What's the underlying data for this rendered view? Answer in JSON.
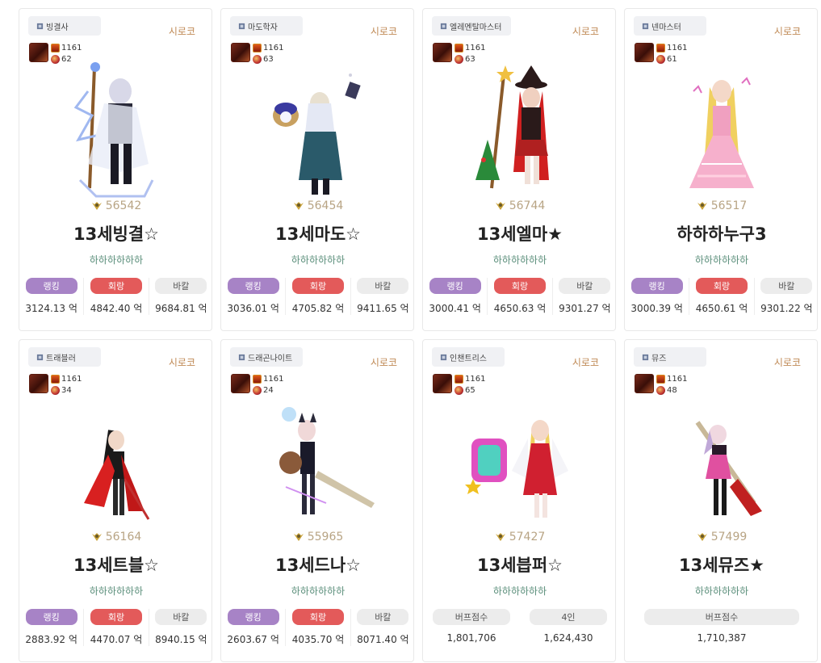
{
  "colors": {
    "rank": "#a783c6",
    "hero": "#e35a5a",
    "bakal": "#ececec",
    "server": "#c08a56",
    "adventure": "#5a8e7a",
    "fame": "#b8a484"
  },
  "cards": [
    {
      "job": "빙결사",
      "server": "시로코",
      "emblem_level": "1161",
      "sub_level": "62",
      "fame": "56542",
      "name": "13세빙결☆",
      "adventure": "하하하하하하",
      "stats": [
        {
          "label": "랭킹",
          "value": "3124.13 억"
        },
        {
          "label": "회랑",
          "value": "4842.40 억"
        },
        {
          "label": "바칼",
          "value": "9684.81 억"
        }
      ]
    },
    {
      "job": "마도학자",
      "server": "시로코",
      "emblem_level": "1161",
      "sub_level": "63",
      "fame": "56454",
      "name": "13세마도☆",
      "adventure": "하하하하하하",
      "stats": [
        {
          "label": "랭킹",
          "value": "3036.01 억"
        },
        {
          "label": "회랑",
          "value": "4705.82 억"
        },
        {
          "label": "바칼",
          "value": "9411.65 억"
        }
      ]
    },
    {
      "job": "엘레멘탈마스터",
      "server": "시로코",
      "emblem_level": "1161",
      "sub_level": "63",
      "fame": "56744",
      "name": "13세엘마★",
      "adventure": "하하하하하하",
      "stats": [
        {
          "label": "랭킹",
          "value": "3000.41 억"
        },
        {
          "label": "회랑",
          "value": "4650.63 억"
        },
        {
          "label": "바칼",
          "value": "9301.27 억"
        }
      ]
    },
    {
      "job": "넨마스터",
      "server": "시로코",
      "emblem_level": "1161",
      "sub_level": "61",
      "fame": "56517",
      "name": "하하하누구3",
      "adventure": "하하하하하하",
      "stats": [
        {
          "label": "랭킹",
          "value": "3000.39 억"
        },
        {
          "label": "회랑",
          "value": "4650.61 억"
        },
        {
          "label": "바칼",
          "value": "9301.22 억"
        }
      ]
    },
    {
      "job": "트래블러",
      "server": "시로코",
      "emblem_level": "1161",
      "sub_level": "34",
      "fame": "56164",
      "name": "13세트블☆",
      "adventure": "하하하하하하",
      "stats": [
        {
          "label": "랭킹",
          "value": "2883.92 억"
        },
        {
          "label": "회랑",
          "value": "4470.07 억"
        },
        {
          "label": "바칼",
          "value": "8940.15 억"
        }
      ]
    },
    {
      "job": "드래곤나이트",
      "server": "시로코",
      "emblem_level": "1161",
      "sub_level": "24",
      "fame": "55965",
      "name": "13세드나☆",
      "adventure": "하하하하하하",
      "stats": [
        {
          "label": "랭킹",
          "value": "2603.67 억"
        },
        {
          "label": "회랑",
          "value": "4035.70 억"
        },
        {
          "label": "바칼",
          "value": "8071.40 억"
        }
      ]
    },
    {
      "job": "인챈트리스",
      "server": "시로코",
      "emblem_level": "1161",
      "sub_level": "65",
      "fame": "57427",
      "name": "13세븝퍼☆",
      "adventure": "하하하하하하",
      "buffs": [
        {
          "label": "버프점수",
          "value": "1,801,706"
        },
        {
          "label": "4인",
          "value": "1,624,430"
        }
      ]
    },
    {
      "job": "뮤즈",
      "server": "시로코",
      "emblem_level": "1161",
      "sub_level": "48",
      "fame": "57499",
      "name": "13세뮤즈★",
      "adventure": "하하하하하하",
      "buffs": [
        {
          "label": "버프점수",
          "value": "1,710,387"
        }
      ]
    }
  ]
}
